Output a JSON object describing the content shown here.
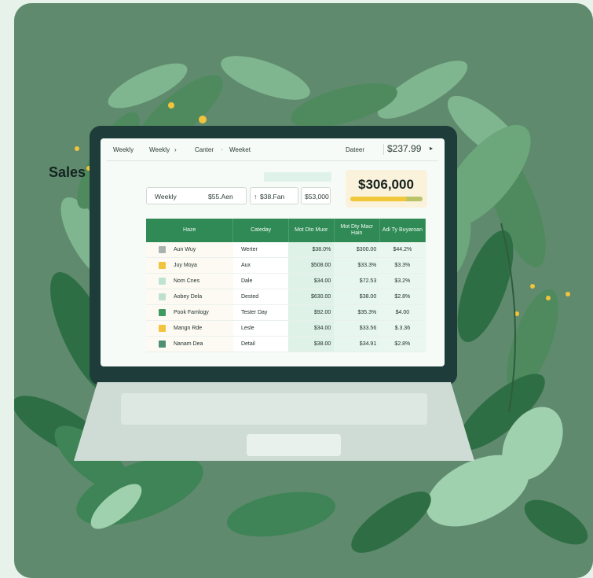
{
  "nav": {
    "item1": "Weekly",
    "item2": "Weekly",
    "item3": "Canter",
    "item4": "Weeket",
    "right_label": "Dateer",
    "right_value": "$237.99"
  },
  "dashboard": {
    "title": "Sales",
    "filters": {
      "f1_label": "Weekly",
      "f1_value": "$55.Aen",
      "f2_value": "$38.Fan",
      "f3_value": "$53,000"
    },
    "total_value": "$306,000",
    "total_progress": 0.78
  },
  "table": {
    "headers": [
      "Haze",
      "Cateday",
      "Mot Dto Muor",
      "Mot Dty Macr Hain",
      "Adi Ty Buyaroan"
    ],
    "rows": [
      {
        "name": "Aun Wuy",
        "category": "Werter",
        "v1": "$38.0%",
        "v2": "$300.00",
        "v3": "$44.2%",
        "swatch": "#a9b3ad"
      },
      {
        "name": "Juy Moya",
        "category": "Aux",
        "v1": "$508.00",
        "v2": "$33.3%",
        "v3": "$3.3%",
        "swatch": "#f2c33c"
      },
      {
        "name": "Nom Cnes",
        "category": "Dale",
        "v1": "$34.00",
        "v2": "$72.53",
        "v3": "$3.2%",
        "swatch": "#bfe3d2"
      },
      {
        "name": "Aobey Dela",
        "category": "Dested",
        "v1": "$630.00",
        "v2": "$38.00",
        "v3": "$2.8%",
        "swatch": "#bfe0d0"
      },
      {
        "name": "Pook Famlogy",
        "category": "Tester Day",
        "v1": "$92.00",
        "v2": "$35.3%",
        "v3": "$4.00",
        "swatch": "#3f9a5f"
      },
      {
        "name": "Mangn Rde",
        "category": "Lesle",
        "v1": "$34.00",
        "v2": "$33.56",
        "v3": "$.3.36",
        "swatch": "#f2c33c"
      },
      {
        "name": "Nanam Dea",
        "category": "Detail",
        "v1": "$38.00",
        "v2": "$34.91",
        "v3": "$2.8%",
        "swatch": "#4e8f72"
      }
    ]
  },
  "colors": {
    "card_bg": "#5f8a6e",
    "header_green": "#2f8a55",
    "accent_yellow": "#f0c83a"
  }
}
